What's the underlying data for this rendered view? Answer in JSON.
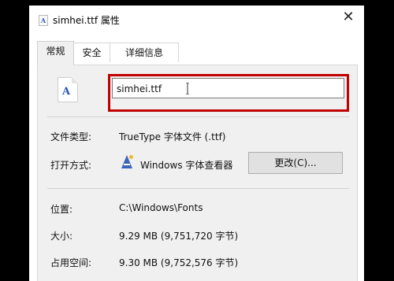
{
  "window": {
    "title": "simhei.ttf 属性",
    "close_label": "✕"
  },
  "tabs": [
    {
      "label": "常规",
      "active": true
    },
    {
      "label": "安全",
      "active": false
    },
    {
      "label": "详细信息",
      "active": false
    }
  ],
  "file": {
    "icon_letter": "A",
    "name": "simhei.ttf"
  },
  "properties": {
    "type_label": "文件类型:",
    "type_value": "TrueType 字体文件 (.ttf)",
    "opener_label": "打开方式:",
    "opener_value": "Windows 字体查看器",
    "change_label": "更改(C)...",
    "location_label": "位置:",
    "location_value": "C:\\Windows\\Fonts",
    "size_label": "大小:",
    "size_value": "9.29 MB (9,751,720 字节)",
    "disk_label": "占用空间:",
    "disk_value": "9.30 MB (9,752,576 字节)"
  },
  "colors": {
    "highlight": "#c10000"
  }
}
